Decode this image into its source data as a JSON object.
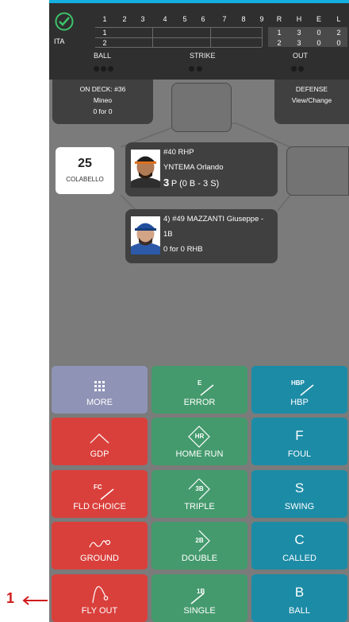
{
  "scoreboard": {
    "team": "ITA",
    "innings": [
      "1",
      "2",
      "3",
      "4",
      "5",
      "6",
      "7",
      "8",
      "9"
    ],
    "totals_headers": [
      "R",
      "H",
      "E",
      "L"
    ],
    "row1_scores": [
      "1"
    ],
    "row2_scores": [
      "2"
    ],
    "row1_totals": [
      "1",
      "3",
      "0",
      "2"
    ],
    "row2_totals": [
      "2",
      "3",
      "0",
      "0"
    ],
    "count_labels": {
      "ball": "BALL",
      "strike": "STRIKE",
      "out": "OUT"
    },
    "balls": 0,
    "strikes": 0,
    "outs": 0
  },
  "ondeck": {
    "title": "ON DECK: #36",
    "name": "Mineo",
    "stat": "0 for 0"
  },
  "defense": {
    "title": "DEFENSE",
    "action": "View/Change"
  },
  "current_batter": {
    "number": "25",
    "name": "COLABELLO"
  },
  "pitcher": {
    "line1": "#40 RHP",
    "name": "YNTEMA Orlando",
    "count_big": "3",
    "count_rest": "P (0 B - 3 S)"
  },
  "hitter": {
    "line1": "4) #49 MAZZANTI Giuseppe -",
    "line2": "1B",
    "stat": "0 for 0 RHB"
  },
  "buttons": [
    {
      "label": "MORE",
      "symbol": "",
      "icon": "grid-icon",
      "color": "#8f93b5"
    },
    {
      "label": "ERROR",
      "symbol": "E",
      "icon": "error-slash-icon",
      "color": "#449a6d"
    },
    {
      "label": "HBP",
      "symbol": "HBP",
      "icon": "hbp-slash-icon",
      "color": "#1c8ba6"
    },
    {
      "label": "GDP",
      "symbol": "",
      "icon": "caret-icon",
      "color": "#d9403c"
    },
    {
      "label": "HOME RUN",
      "symbol": "HR",
      "icon": "diamond-icon",
      "color": "#449a6d"
    },
    {
      "label": "FOUL",
      "symbol": "F",
      "icon": "letter-icon",
      "color": "#1c8ba6"
    },
    {
      "label": "FLD CHOICE",
      "symbol": "FC",
      "icon": "fc-slash-icon",
      "color": "#d9403c"
    },
    {
      "label": "TRIPLE",
      "symbol": "3B",
      "icon": "triple-diamond-icon",
      "color": "#449a6d"
    },
    {
      "label": "SWING",
      "symbol": "S",
      "icon": "letter-icon",
      "color": "#1c8ba6"
    },
    {
      "label": "GROUND",
      "symbol": "",
      "icon": "ground-ball-icon",
      "color": "#d9403c"
    },
    {
      "label": "DOUBLE",
      "symbol": "2B",
      "icon": "double-chevron-icon",
      "color": "#449a6d"
    },
    {
      "label": "CALLED",
      "symbol": "C",
      "icon": "letter-icon",
      "color": "#1c8ba6"
    },
    {
      "label": "FLY OUT",
      "symbol": "",
      "icon": "fly-arc-icon",
      "color": "#d9403c"
    },
    {
      "label": "SINGLE",
      "symbol": "1B",
      "icon": "single-slash-icon",
      "color": "#449a6d"
    },
    {
      "label": "BALL",
      "symbol": "B",
      "icon": "letter-icon",
      "color": "#1c8ba6"
    }
  ],
  "annotation": {
    "label": "1"
  }
}
